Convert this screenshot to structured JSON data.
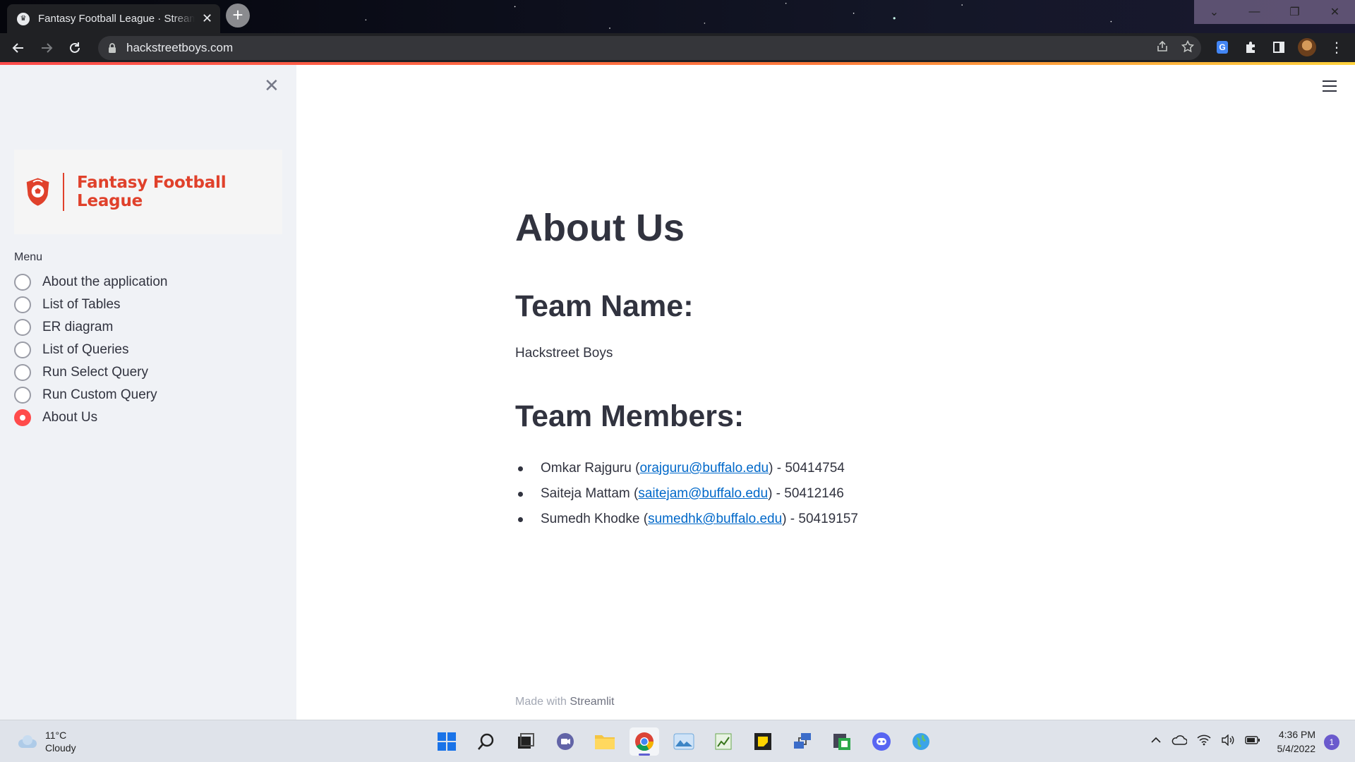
{
  "browser": {
    "tab_title": "Fantasy Football League · Streamlit",
    "url": "hackstreetboys.com",
    "new_tab_symbol": "+",
    "tab_close_symbol": "✕",
    "window_controls": [
      "⌄",
      "—",
      "❐",
      "✕"
    ],
    "toolbar_icons": [
      "back-icon",
      "forward-icon",
      "reload-icon",
      "lock-icon",
      "share-icon",
      "star-icon",
      "translate-icon",
      "puzzle-icon",
      "side-panel-icon",
      "profile-avatar",
      "kebab-menu-icon"
    ]
  },
  "sidebar": {
    "close_symbol": "✕",
    "logo_text": "Fantasy Football League",
    "menu_label": "Menu",
    "items": [
      {
        "label": "About the application",
        "selected": false
      },
      {
        "label": "List of Tables",
        "selected": false
      },
      {
        "label": "ER diagram",
        "selected": false
      },
      {
        "label": "List of Queries",
        "selected": false
      },
      {
        "label": "Run Select Query",
        "selected": false
      },
      {
        "label": "Run Custom Query",
        "selected": false
      },
      {
        "label": "About Us",
        "selected": true
      }
    ]
  },
  "main": {
    "title": "About Us",
    "team_name_heading": "Team Name:",
    "team_name": "Hackstreet Boys",
    "team_members_heading": "Team Members:",
    "members": [
      {
        "name": "Omkar Rajguru",
        "email": "orajguru@buffalo.edu",
        "id": "50414754"
      },
      {
        "name": "Saiteja Mattam",
        "email": "saitejam@buffalo.edu",
        "id": "50412146"
      },
      {
        "name": "Sumedh Khodke",
        "email": "sumedhk@buffalo.edu",
        "id": "50419157"
      }
    ],
    "footer_prefix": "Made with",
    "footer_brand": "Streamlit"
  },
  "taskbar": {
    "weather_temp": "11°C",
    "weather_desc": "Cloudy",
    "time": "4:36 PM",
    "date": "5/4/2022",
    "notification_count": "1",
    "apps": [
      "windows-start-icon",
      "search-icon",
      "task-view-icon",
      "teams-chat-icon",
      "file-explorer-icon",
      "chrome-icon",
      "photos-icon",
      "spreadsheet-icon",
      "sticky-notes-icon",
      "network-app-icon",
      "snipping-tool-icon",
      "discord-icon",
      "globe-app-icon"
    ]
  },
  "colors": {
    "accent": "#ff4b4b",
    "logo_red": "#e0412b",
    "link": "#0068c9",
    "text": "#31333f",
    "sidebar_bg": "#f0f2f6"
  }
}
